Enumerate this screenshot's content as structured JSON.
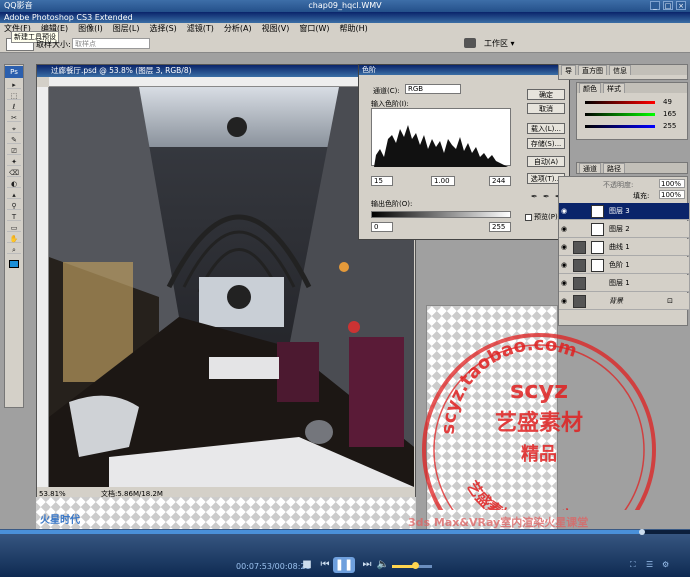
{
  "player": {
    "app_title": "QQ影音",
    "file_title": "chap09_hqcl.WMV",
    "controls": [
      "_",
      "□",
      "×"
    ],
    "elapsed": "00:07:53",
    "total": "00:08:28",
    "separator": "/",
    "progress_fraction": 0.93,
    "volume_fraction": 0.55
  },
  "ps": {
    "title": "Adobe Photoshop CS3 Extended"
  },
  "menubar": {
    "items": [
      "文件(F)",
      "编辑(E)",
      "图像(I)",
      "图层(L)",
      "选择(S)",
      "滤镜(T)",
      "分析(A)",
      "视图(V)",
      "窗口(W)",
      "帮助(H)"
    ]
  },
  "optbar": {
    "hint": "新建工具预设",
    "sample_label": "取样大小:",
    "sample_value": "取样点",
    "workspace_label": "工作区 ▾"
  },
  "toolbox": {
    "logo": "Ps",
    "tools": [
      "▸",
      "⬚",
      "ℓ",
      "✂",
      "⌖",
      "✎",
      "⎚",
      "✦",
      "⌫",
      "◐",
      "▴",
      "⚲",
      "T",
      "▭",
      "✋",
      "⌕"
    ]
  },
  "document": {
    "title": "过廊餐厅.psd @ 53.8% (图层 3, RGB/8)",
    "zoom": "53.81%",
    "doc_size": "文档:5.86M/18.2M"
  },
  "levels": {
    "title": "色阶",
    "channel_label": "通道(C):",
    "channel_value": "RGB",
    "input_label": "输入色阶(I):",
    "input_values": [
      "15",
      "1.00",
      "244"
    ],
    "output_label": "输出色阶(O):",
    "output_values": [
      "0",
      "255"
    ],
    "buttons": [
      "确定",
      "取消",
      "载入(L)...",
      "存储(S)...",
      "自动(A)",
      "选项(T)..."
    ],
    "preview_label": "预览(P)",
    "eyedroppers": [
      "✒",
      "✒",
      "✒"
    ]
  },
  "panels": {
    "nav_tabs": [
      "导",
      "直方图",
      "信息"
    ],
    "color_tabs": [
      "颜色",
      "样式"
    ],
    "color_values": [
      "49",
      "165",
      "255"
    ],
    "channel_tabs": [
      "通道",
      "路径"
    ],
    "layer_options": {
      "opacity_label": "不透明度:",
      "opacity": "100%",
      "fill_label": "填充:",
      "fill": "100%"
    },
    "layers": [
      {
        "name": "图层 3",
        "selected": true
      },
      {
        "name": "图层 2",
        "selected": false
      },
      {
        "name": "曲线 1",
        "selected": false
      },
      {
        "name": "色阶 1",
        "selected": false
      },
      {
        "name": "图层 1",
        "selected": false
      },
      {
        "name": "背景",
        "selected": false
      }
    ]
  },
  "watermark": {
    "ring_top": "scyz.taobao.com",
    "center_brand": "scyz",
    "center_name": "艺盛素材",
    "center_badge": "精品",
    "ring_bottom": "艺盛素材 精品特供",
    "bottom_caption": "3ds Max&VRay室内渲染火星课堂",
    "bottom_logo": "火星时代",
    "color": "#e02020"
  }
}
